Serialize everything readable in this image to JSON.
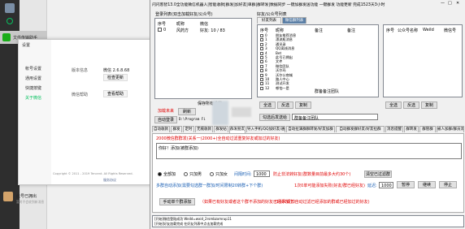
{
  "app_title": "闪闪客智13.0全功能微信机器人|智能收款|群发|加好友|单群|群转发|数据同步 一键加群发送功能 一键群发 功能更新 完成1523天3小时",
  "wechat": {
    "file_helper": "文件传输助手",
    "settings_window": {
      "title": "设置",
      "menu": [
        "帐号设置",
        "通用设置",
        "快捷按键",
        "关于微信"
      ],
      "version_label": "版本信息",
      "version_value": "微信 2.6.8.68",
      "check_update": "检查更新",
      "help_label": "微信帮助",
      "help_button": "查看帮助",
      "copyright": "Copyright © 2011 - 2019 Tencent. All Rights Reserved.",
      "agreement": "服务协议"
    },
    "chat_last": "此号已拥出",
    "chat_last_sub": "暂时不会收到新消息"
  },
  "login_list": {
    "title": "登录列表(双击加载好友/公众号)",
    "headers": [
      "序号",
      "昵称",
      "微信"
    ],
    "rows": [
      [
        "0",
        "风药方",
        "好友: 10 / 83"
      ]
    ],
    "load_button": "加载未来",
    "refresh_button": "刷新",
    "save_button": "保存所有设置",
    "autologin": "自动登录",
    "path": "D:\\Program Fi"
  },
  "friend_list": {
    "title": "好友/公众号列表",
    "tabs": [
      "好友列表",
      "微信群列表"
    ],
    "left_headers": [
      "序号",
      "昵称",
      "备注",
      "备注"
    ],
    "left_rows": [
      [
        "0",
        "朋友推荐消息"
      ],
      [
        "1",
        "漂流瓶消息"
      ],
      [
        "2",
        "通讯录"
      ],
      [
        "3",
        "QQ离线消息"
      ],
      [
        "4",
        "Bet"
      ],
      [
        "5",
        "此号已拥出"
      ],
      [
        "6",
        "文件"
      ],
      [
        "7",
        "微信团队"
      ],
      [
        "8",
        "沃尔玛"
      ],
      [
        "9",
        "沃尔公商城"
      ],
      [
        "10",
        "路人中心"
      ],
      [
        "11",
        "测试开发"
      ],
      [
        "12",
        "哪怕一是"
      ]
    ],
    "left_extra": "群备备注团队",
    "right_headers": [
      "序号",
      "公众号名称",
      "WeiId",
      "微信号"
    ],
    "buttons_left": [
      "全选",
      "反选",
      "复制"
    ],
    "buttons_right": [
      "全选",
      "反选",
      "复制"
    ],
    "input_hint": "勾选后发送给",
    "input_hint2": "群备备注团队"
  },
  "tabs": [
    "自动收款",
    "群发",
    "定时",
    "无痕收款",
    "群发帖",
    "群发朋友",
    "导入手机/QQ加好友/通讯录",
    "自动拉满群群转发/好友加群",
    "自动群发群好友/好友拉群",
    "消息提醒",
    "群转发",
    "群管群",
    "被人加群/群员添加",
    "导出"
  ],
  "active_tab_index": 5,
  "mass_send": {
    "group_title": "2000微信群群发(关系一(2000+)全自动过滤重复好友或加过的好友)",
    "input_text": "你好！添加(被群添加)",
    "radio_all": "全部加",
    "radio_male": "只加男",
    "radio_female": "只加女",
    "interval_label": "间隔时间:",
    "interval_value": "1000",
    "warn1": "防止非法转好友(群数量目前最多大约30个)",
    "filter_button": "清空已过滤群",
    "multi_label": "多群自动添加(需要勾选群一群加/时间限制20转群+下个群)",
    "multi_warn": "1次0单可能添加失败(好友/群已经好友)",
    "count_label": "延迟:",
    "count_value": "1000",
    "pause": "暂停",
    "continue": "继续",
    "stop": "停止",
    "manual_button": "手动单个群添加",
    "manual_warn": "（如果已有好友或者这个群不添加的好友已经添加了）",
    "manual_warn2": "(1000请加自动过滤已经添加的群或已经加过的好友)"
  },
  "log": {
    "line1": "[开始]微信登陆成功 WeiId=wxid_2rsmbzxmrup11",
    "line2": "[开始]好友加载完成 在好友列表中点击加载完成"
  }
}
